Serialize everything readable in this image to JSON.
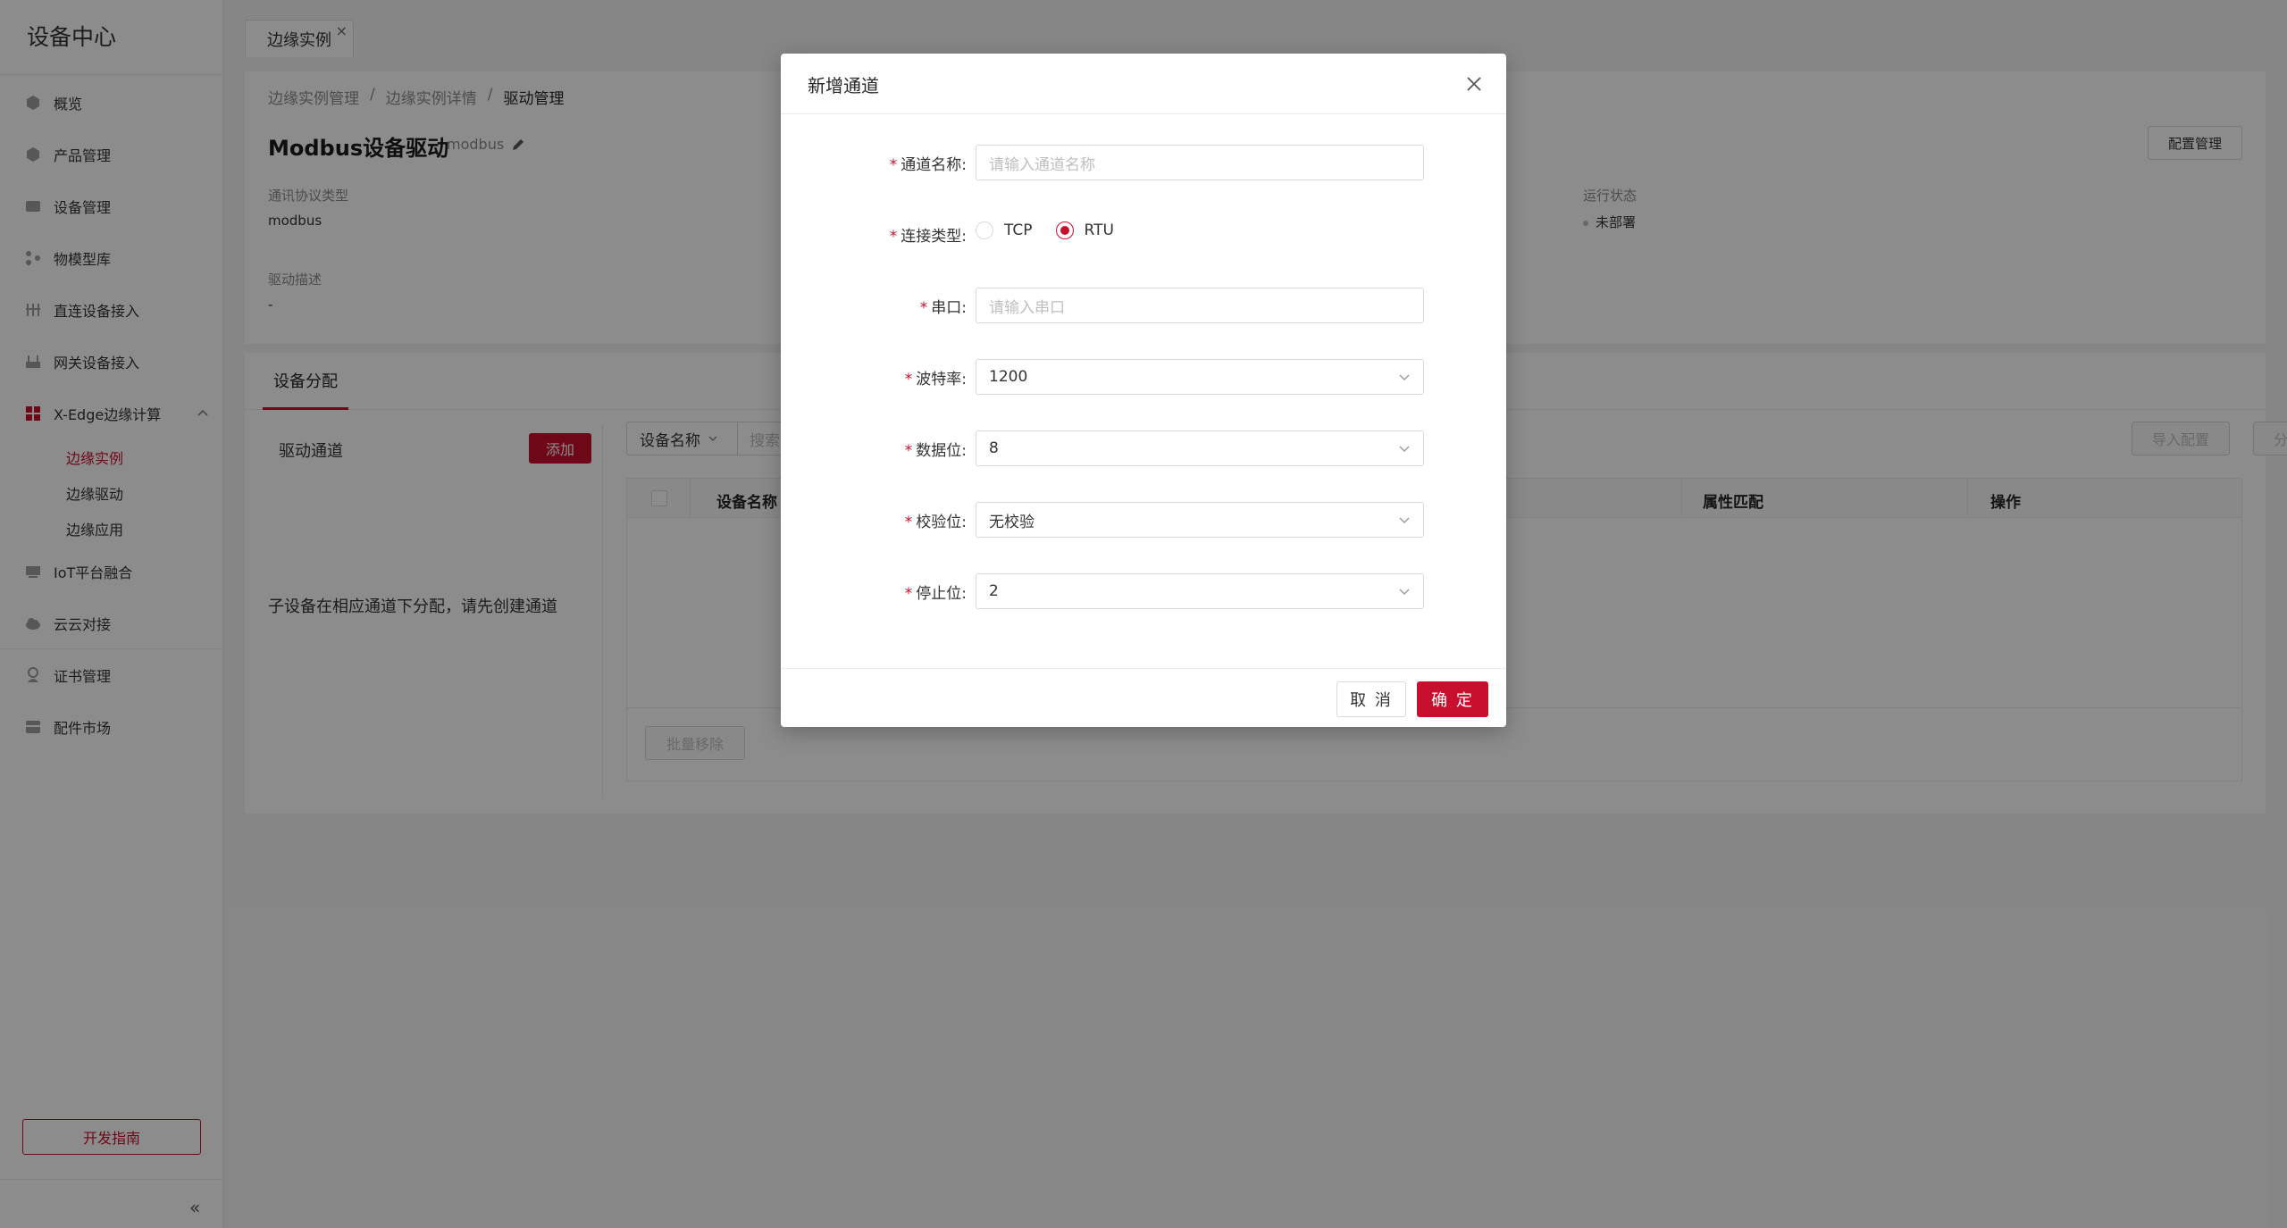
{
  "sidebar": {
    "title": "设备中心",
    "items": [
      {
        "label": "概览",
        "icon": "cube-icon"
      },
      {
        "label": "产品管理",
        "icon": "product-icon"
      },
      {
        "label": "设备管理",
        "icon": "device-icon"
      },
      {
        "label": "物模型库",
        "icon": "model-icon"
      },
      {
        "label": "直连设备接入",
        "icon": "direct-icon"
      },
      {
        "label": "网关设备接入",
        "icon": "gateway-icon"
      },
      {
        "label": "X-Edge边缘计算",
        "icon": "grid-icon"
      },
      {
        "label": "IoT平台融合",
        "icon": "iot-icon"
      },
      {
        "label": "云云对接",
        "icon": "cloud-icon"
      },
      {
        "label": "证书管理",
        "icon": "cert-icon"
      },
      {
        "label": "配件市场",
        "icon": "market-icon"
      }
    ],
    "sub_items": [
      "边缘实例",
      "边缘驱动",
      "边缘应用"
    ],
    "guide_label": "开发指南",
    "collapse_glyph": "«"
  },
  "tab": {
    "label": "边缘实例",
    "close": "×"
  },
  "breadcrumb": [
    "边缘实例管理",
    "边缘实例详情",
    "驱动管理"
  ],
  "breadcrumb_sep": "/",
  "header": {
    "title": "Modbus设备驱动",
    "subtitle": "modbus",
    "config_button": "配置管理"
  },
  "info": {
    "protocol_label": "通讯协议类型",
    "protocol_value": "modbus",
    "status_label": "运行状态",
    "status_value": "未部署",
    "desc_label": "驱动描述",
    "desc_value": "-"
  },
  "assign": {
    "tab_label": "设备分配",
    "channel_title": "驱动通道",
    "add_button": "添加",
    "empty_tip": "子设备在相应通道下分配，请先创建通道",
    "filter_field": "设备名称",
    "search_placeholder": "搜索",
    "import_button": "导入配置",
    "assign_button": "分配设备",
    "columns": [
      "设备名称",
      "属性匹配",
      "操作"
    ],
    "batch_remove": "批量移除"
  },
  "modal": {
    "title": "新增通道",
    "fields": {
      "name_label": "通道名称",
      "name_placeholder": "请输入通道名称",
      "conn_label": "连接类型",
      "conn_options": [
        "TCP",
        "RTU"
      ],
      "conn_selected": "RTU",
      "serial_label": "串口",
      "serial_placeholder": "请输入串口",
      "baud_label": "波特率",
      "baud_value": "1200",
      "databits_label": "数据位",
      "databits_value": "8",
      "parity_label": "校验位",
      "parity_value": "无校验",
      "stopbits_label": "停止位",
      "stopbits_value": "2"
    },
    "label_suffix": ":",
    "required_mark": "*",
    "cancel": "取 消",
    "ok": "确 定"
  },
  "colors": {
    "accent": "#c8102e"
  }
}
